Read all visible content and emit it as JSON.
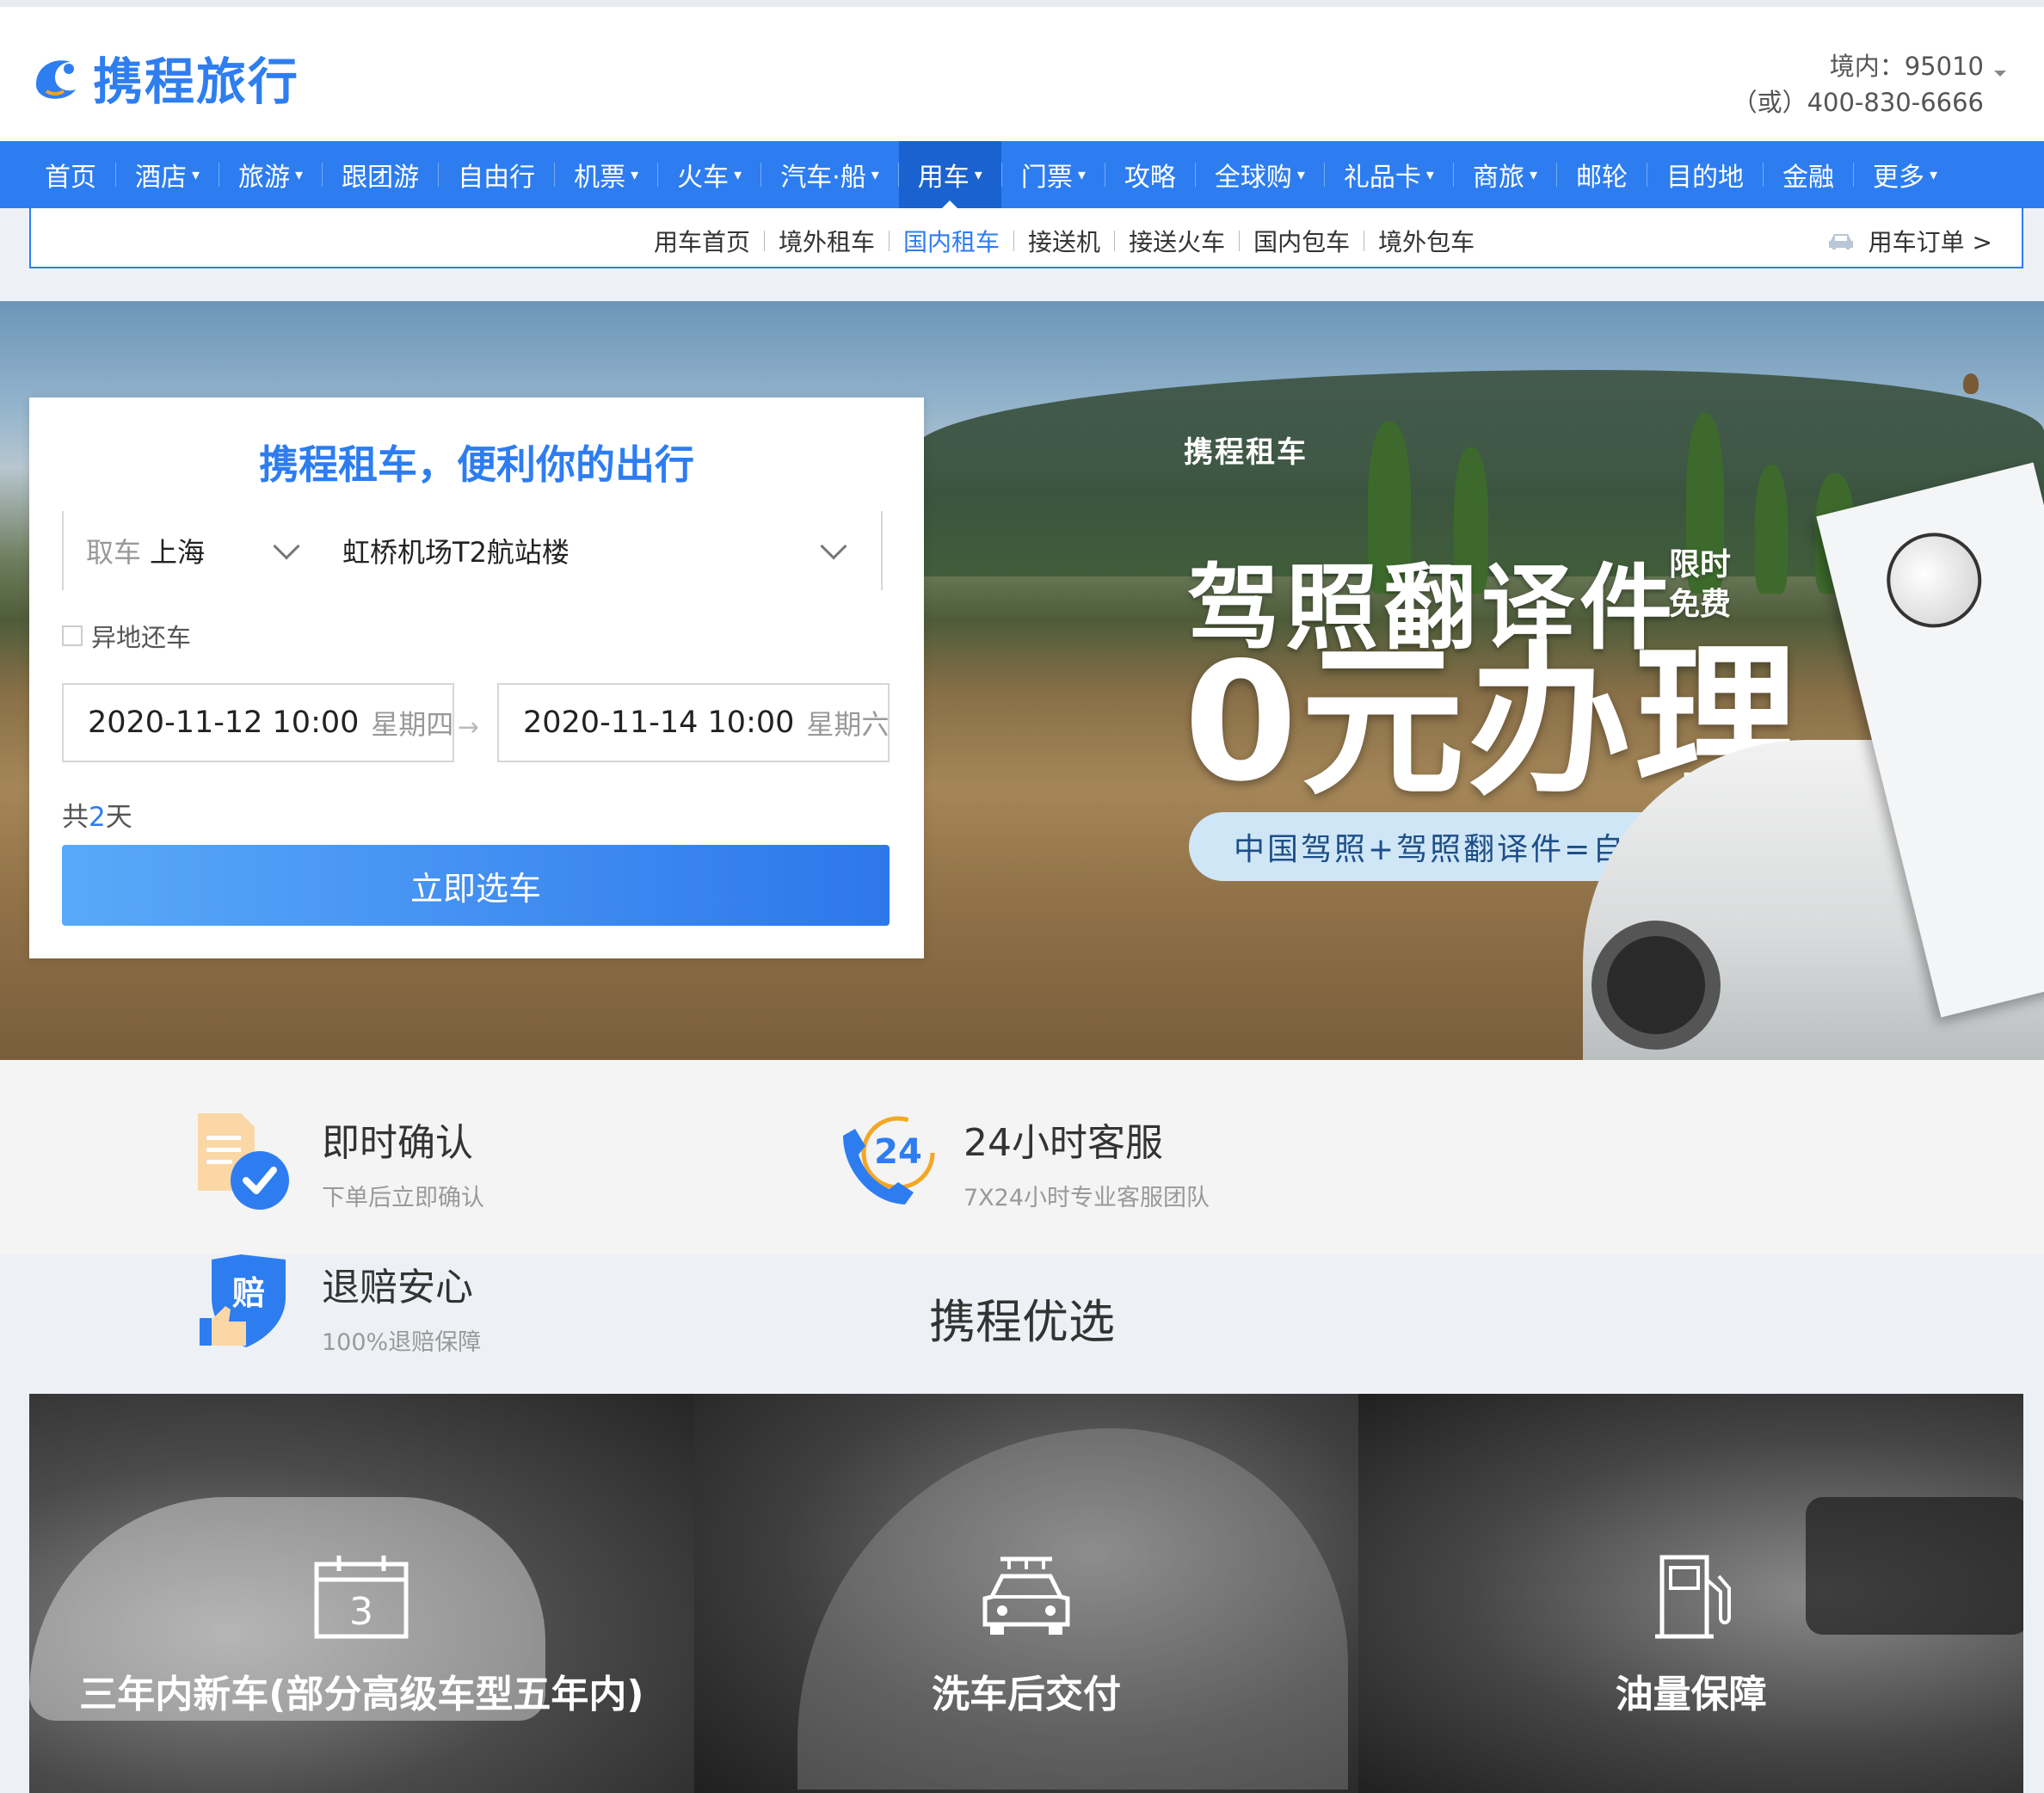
{
  "brand": {
    "name": "携程旅行",
    "accent": "#2d7df1"
  },
  "hotline": {
    "domestic": "境内：95010",
    "alt": "（或）400-830-6666"
  },
  "main_nav": [
    {
      "label": "首页",
      "dropdown": false,
      "active": false
    },
    {
      "label": "酒店",
      "dropdown": true,
      "active": false
    },
    {
      "label": "旅游",
      "dropdown": true,
      "active": false
    },
    {
      "label": "跟团游",
      "dropdown": false,
      "active": false
    },
    {
      "label": "自由行",
      "dropdown": false,
      "active": false
    },
    {
      "label": "机票",
      "dropdown": true,
      "active": false
    },
    {
      "label": "火车",
      "dropdown": true,
      "active": false
    },
    {
      "label": "汽车·船",
      "dropdown": true,
      "active": false
    },
    {
      "label": "用车",
      "dropdown": true,
      "active": true
    },
    {
      "label": "门票",
      "dropdown": true,
      "active": false
    },
    {
      "label": "攻略",
      "dropdown": false,
      "active": false
    },
    {
      "label": "全球购",
      "dropdown": true,
      "active": false
    },
    {
      "label": "礼品卡",
      "dropdown": true,
      "active": false
    },
    {
      "label": "商旅",
      "dropdown": true,
      "active": false
    },
    {
      "label": "邮轮",
      "dropdown": false,
      "active": false
    },
    {
      "label": "目的地",
      "dropdown": false,
      "active": false
    },
    {
      "label": "金融",
      "dropdown": false,
      "active": false
    },
    {
      "label": "更多",
      "dropdown": true,
      "active": false
    }
  ],
  "sub_nav": {
    "links": [
      "用车首页",
      "境外租车",
      "国内租车",
      "接送机",
      "接送火车",
      "国内包车",
      "境外包车"
    ],
    "active_index": 2,
    "order_label": "用车订单 >"
  },
  "hero": {
    "tagline": "携程租车",
    "promo_line1": "驾照翻译件",
    "promo_limit_1": "限时",
    "promo_limit_2": "免费",
    "promo_line2": "0元办理",
    "promo_pill": "中国驾照+驾照翻译件=自驾全球200国"
  },
  "search": {
    "title": "携程租车，便利你的出行",
    "pickup_label": "取车",
    "city": "上海",
    "place": "虹桥机场T2航站楼",
    "diff_return_label": "异地还车",
    "start_date": "2020-11-12 10:00",
    "start_weekday": "星期四",
    "end_date": "2020-11-14 10:00",
    "end_weekday": "星期六",
    "days_prefix": "共",
    "days_value": "2",
    "days_suffix": "天",
    "submit_label": "立即选车"
  },
  "features": [
    {
      "title": "即时确认",
      "subtitle": "下单后立即确认",
      "icon": "document-check-icon"
    },
    {
      "title": "24小时客服",
      "subtitle": "7X24小时专业客服团队",
      "icon": "phone-24-icon"
    },
    {
      "title": "退赔安心",
      "subtitle": "100%退赔保障",
      "icon": "shield-compensation-icon"
    }
  ],
  "shield_glyph": "赔",
  "phone_badge": "24",
  "calendar_glyph": "3",
  "picks": {
    "title": "携程优选",
    "cards": [
      {
        "label": "三年内新车(部分高级车型五年内)",
        "icon": "calendar-icon"
      },
      {
        "label": "洗车后交付",
        "icon": "car-wash-icon"
      },
      {
        "label": "油量保障",
        "icon": "fuel-pump-icon"
      }
    ]
  }
}
